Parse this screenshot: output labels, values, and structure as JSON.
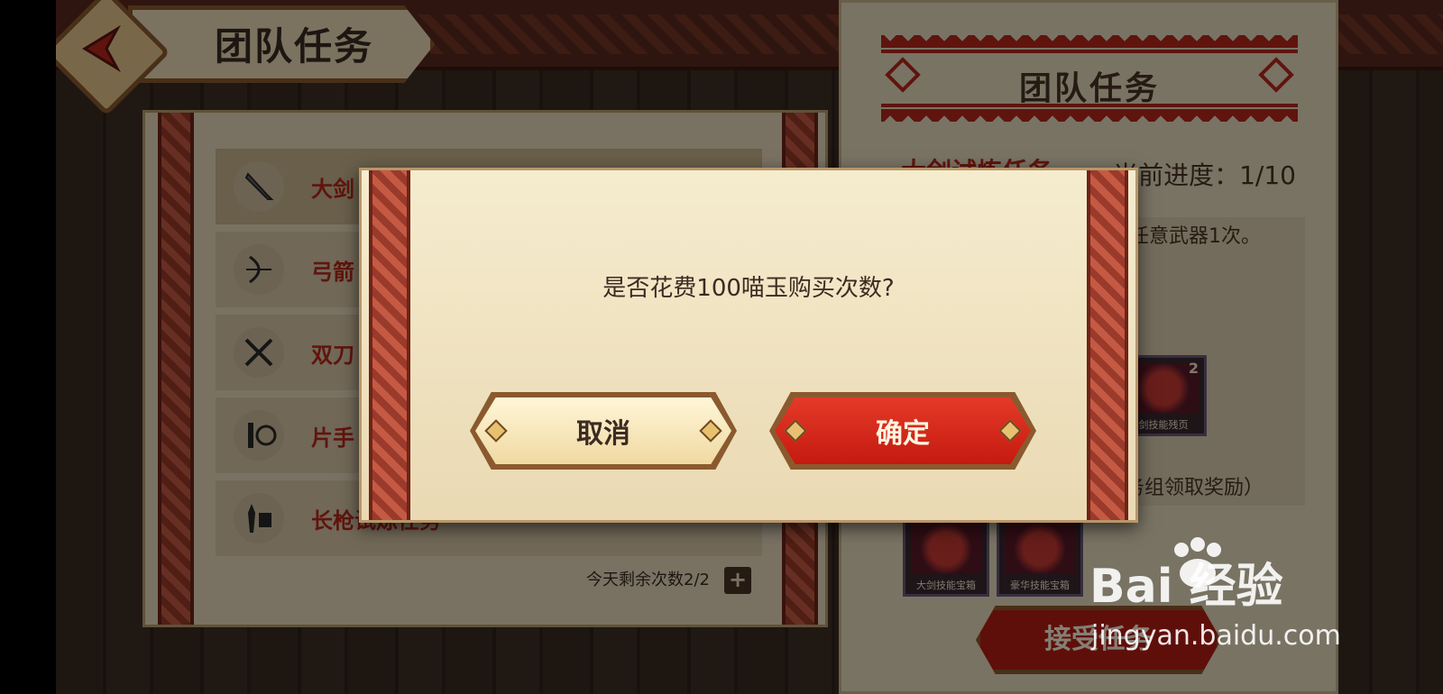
{
  "header": {
    "title": "团队任务"
  },
  "task_list": {
    "items": [
      {
        "label": "大剑",
        "icon": "great-sword-icon",
        "active": true
      },
      {
        "label": "弓箭",
        "icon": "bow-icon",
        "active": false
      },
      {
        "label": "双刀",
        "icon": "dual-blades-icon",
        "active": false
      },
      {
        "label": "片手",
        "icon": "sword-shield-icon",
        "active": false
      },
      {
        "label": "长枪试炼任务",
        "icon": "lance-icon",
        "active": false
      }
    ],
    "remaining_text": "今天剩余次数2/2",
    "plus_label": "+"
  },
  "detail": {
    "title": "团队任务",
    "task_name": "大剑试炼任务",
    "progress": "当前进度：1/10",
    "description": "阶任意武器1次。",
    "reward_note": "务组领取奖励）",
    "rewards": [
      {
        "caption": "剑技能残页",
        "count": "2"
      },
      {
        "caption": "大剑技能宝箱",
        "count": ""
      },
      {
        "caption": "豪华技能宝箱",
        "count": ""
      }
    ],
    "accept_button": "接受任务"
  },
  "dialog": {
    "message": "是否花费100喵玉购买次数?",
    "cancel_label": "取消",
    "confirm_label": "确定"
  },
  "watermark": {
    "logo": "Bai  经验",
    "url": "jingyan.baidu.com"
  },
  "colors": {
    "accent_red": "#b8281c",
    "parchment": "#e8dbbf",
    "confirm_red": "#c41a10",
    "wood_brown": "#8a5a2e"
  }
}
